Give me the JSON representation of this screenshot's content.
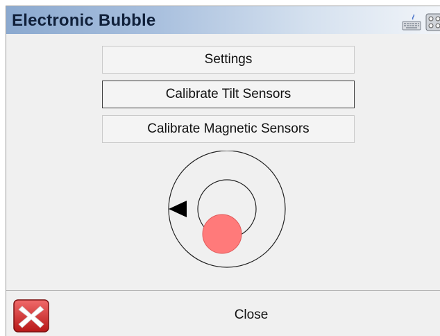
{
  "window": {
    "title": "Electronic Bubble"
  },
  "titlebar_icons": {
    "keyboard": "keyboard-icon",
    "menu": "menu-grid-icon"
  },
  "buttons": {
    "settings": "Settings",
    "calibrate_tilt": "Calibrate Tilt Sensors",
    "calibrate_magnetic": "Calibrate Magnetic Sensors"
  },
  "bubble_level": {
    "indicator_color": "#ff6b6b",
    "direction_arrow": "left"
  },
  "footer": {
    "close_label": "Close",
    "close_icon": "red-x-close-icon"
  },
  "colors": {
    "title_gradient_start": "#8ba9cf",
    "title_gradient_end": "#f2f5f9",
    "bubble": "#ff7a7a",
    "close_icon_red": "#d42a2a"
  }
}
